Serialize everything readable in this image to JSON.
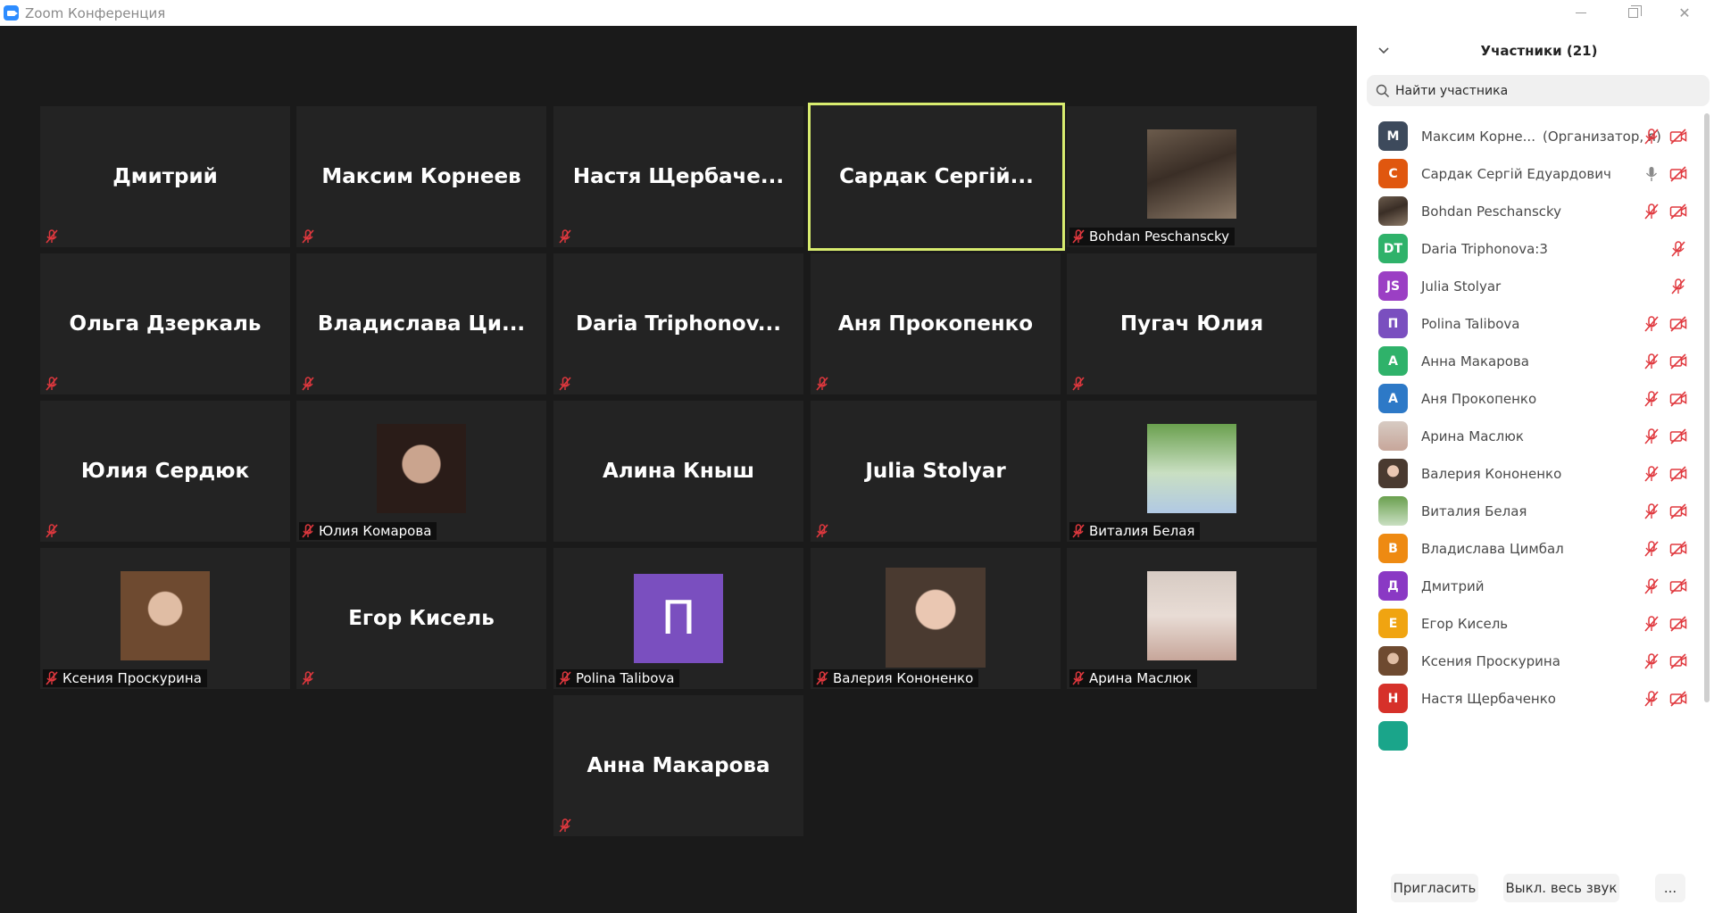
{
  "window": {
    "title": "Zoom Конференция"
  },
  "colors": {
    "muted_red": "#e0383e",
    "speaker_border": "#d8ec6f",
    "tile_bg": "#232323",
    "video_bg": "#1a1a1a"
  },
  "tiles": [
    {
      "big": "Дмитрий",
      "tag": ""
    },
    {
      "big": "Максим Корнеев",
      "tag": ""
    },
    {
      "big": "Настя  Щербаче...",
      "tag": ""
    },
    {
      "big": "Сардак  Сергій...",
      "tag": ""
    },
    {
      "big": "",
      "tag": "Bohdan Peschanscky"
    },
    {
      "big": "Ольга Дзеркаль",
      "tag": ""
    },
    {
      "big": "Владислава  Ци...",
      "tag": ""
    },
    {
      "big": "Daria  Triphonov...",
      "tag": ""
    },
    {
      "big": "Аня Прокопенко",
      "tag": ""
    },
    {
      "big": "Пугач Юлия",
      "tag": ""
    },
    {
      "big": "Юлия Сердюк",
      "tag": ""
    },
    {
      "big": "",
      "tag": "Юлия Комарова"
    },
    {
      "big": "Алина Кныш",
      "tag": ""
    },
    {
      "big": "Julia Stolyar",
      "tag": ""
    },
    {
      "big": "",
      "tag": "Виталия Белая"
    },
    {
      "big": "",
      "tag": "Ксения Проскурина"
    },
    {
      "big": "Егор Кисель",
      "tag": ""
    },
    {
      "big": "П",
      "tag": "Polina Talibova"
    },
    {
      "big": "",
      "tag": "Валерия Кононенко"
    },
    {
      "big": "",
      "tag": "Арина Маслюк"
    },
    {
      "big": "Анна Макарова",
      "tag": ""
    }
  ],
  "panel": {
    "title": "Участники (21)",
    "search_placeholder": "Найти участника",
    "participants": [
      {
        "initials": "М",
        "color": "#3d4a5c",
        "name": "Максим Корне...",
        "role": "(Организатор, я)"
      },
      {
        "initials": "С",
        "color": "#e0570f",
        "name": "Сардак Сергій Едуардович",
        "role": ""
      },
      {
        "initials": "",
        "color": "#6b5b4c",
        "name": "Bohdan Peschanscky",
        "role": ""
      },
      {
        "initials": "DT",
        "color": "#2fb26a",
        "name": "Daria Triphonova:3",
        "role": ""
      },
      {
        "initials": "JS",
        "color": "#9b3fc4",
        "name": "Julia Stolyar",
        "role": ""
      },
      {
        "initials": "П",
        "color": "#7a4fbf",
        "name": "Polina Talibova",
        "role": ""
      },
      {
        "initials": "А",
        "color": "#2fb26a",
        "name": "Анна Макарова",
        "role": ""
      },
      {
        "initials": "А",
        "color": "#2d79c7",
        "name": "Аня Прокопенко",
        "role": ""
      },
      {
        "initials": "",
        "color": "#d7cbc3",
        "name": "Арина Маслюк",
        "role": ""
      },
      {
        "initials": "",
        "color": "#4a3a30",
        "name": "Валерия Кононенко",
        "role": ""
      },
      {
        "initials": "",
        "color": "#6aa04e",
        "name": "Виталия Белая",
        "role": ""
      },
      {
        "initials": "В",
        "color": "#ee8a12",
        "name": "Владислава Цимбал",
        "role": ""
      },
      {
        "initials": "Д",
        "color": "#8a39c4",
        "name": "Дмитрий",
        "role": ""
      },
      {
        "initials": "Е",
        "color": "#f0a411",
        "name": "Егор Кисель",
        "role": ""
      },
      {
        "initials": "",
        "color": "#6e4a30",
        "name": "Ксения Проскурина",
        "role": ""
      },
      {
        "initials": "Н",
        "color": "#d6312a",
        "name": "Настя Щербаченко",
        "role": ""
      }
    ],
    "buttons": {
      "invite": "Пригласить",
      "mute_all": "Выкл. весь звук",
      "more": "..."
    }
  }
}
